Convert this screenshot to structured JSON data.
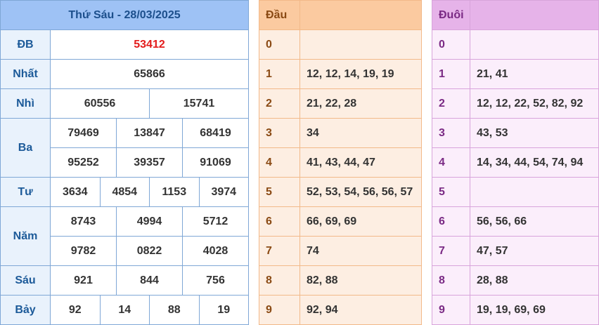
{
  "title": "Thứ Sáu - 28/03/2025",
  "colors": {
    "special": "#e31b1b",
    "header_blue": "#9ec2f5",
    "header_orange": "#fbcaa0",
    "header_purple": "#e6b3e9"
  },
  "prizes": {
    "db": {
      "label": "ĐB",
      "values": [
        "53412"
      ]
    },
    "nhat": {
      "label": "Nhất",
      "values": [
        "65866"
      ]
    },
    "nhi": {
      "label": "Nhì",
      "values": [
        "60556",
        "15741"
      ]
    },
    "ba": {
      "label": "Ba",
      "values": [
        "79469",
        "13847",
        "68419",
        "95252",
        "39357",
        "91069"
      ]
    },
    "tu": {
      "label": "Tư",
      "values": [
        "3634",
        "4854",
        "1153",
        "3974"
      ]
    },
    "nam": {
      "label": "Năm",
      "values": [
        "8743",
        "4994",
        "5712",
        "9782",
        "0822",
        "4028"
      ]
    },
    "sau": {
      "label": "Sáu",
      "values": [
        "921",
        "844",
        "756"
      ]
    },
    "bay": {
      "label": "Bảy",
      "values": [
        "92",
        "14",
        "88",
        "19"
      ]
    }
  },
  "dau": {
    "header": "Đầu",
    "rows": [
      {
        "num": "0",
        "list": ""
      },
      {
        "num": "1",
        "list": "12, 12, 14, 19, 19"
      },
      {
        "num": "2",
        "list": "21, 22, 28"
      },
      {
        "num": "3",
        "list": "34"
      },
      {
        "num": "4",
        "list": "41, 43, 44, 47"
      },
      {
        "num": "5",
        "list": "52, 53, 54, 56, 56, 57"
      },
      {
        "num": "6",
        "list": "66, 69, 69"
      },
      {
        "num": "7",
        "list": "74"
      },
      {
        "num": "8",
        "list": "82, 88"
      },
      {
        "num": "9",
        "list": "92, 94"
      }
    ]
  },
  "duoi": {
    "header": "Đuôi",
    "rows": [
      {
        "num": "0",
        "list": ""
      },
      {
        "num": "1",
        "list": "21, 41"
      },
      {
        "num": "2",
        "list": "12, 12, 22, 52, 82, 92"
      },
      {
        "num": "3",
        "list": "43, 53"
      },
      {
        "num": "4",
        "list": "14, 34, 44, 54, 74, 94"
      },
      {
        "num": "5",
        "list": ""
      },
      {
        "num": "6",
        "list": "56, 56, 66"
      },
      {
        "num": "7",
        "list": "47, 57"
      },
      {
        "num": "8",
        "list": "28, 88"
      },
      {
        "num": "9",
        "list": "19, 19, 69, 69"
      }
    ]
  }
}
